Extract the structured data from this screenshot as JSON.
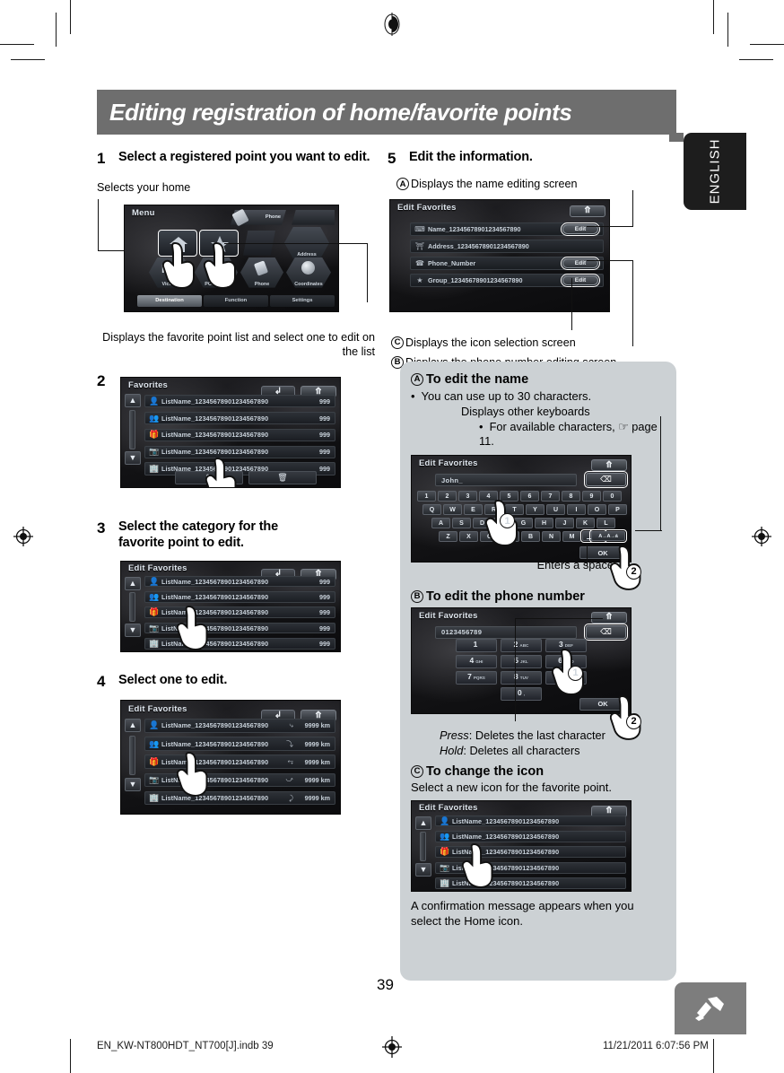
{
  "document": {
    "header_title": "Editing registration of home/favorite points",
    "page_number": "39",
    "language_tab": "ENGLISH",
    "footer_file": "EN_KW-NT800HDT_NT700[J].indb   39",
    "footer_page": "39",
    "footer_timestamp": "11/21/2011   6:07:56 PM",
    "colors": {
      "header_bar": "#6e6e6e",
      "info_box": "#ccd1d4",
      "lang_tab": "#1d1d1d",
      "badge": "#7d7d7d"
    }
  },
  "steps": {
    "step1": {
      "num": "1",
      "text": "Select a registered point you want to edit.",
      "caption_home": "Selects your home",
      "caption_favorites": "Displays the favorite point list and select one to edit on the list"
    },
    "step2": {
      "num": "2"
    },
    "step3": {
      "num": "3",
      "text": "Select the category for the favorite point to edit."
    },
    "step4": {
      "num": "4",
      "text": "Select one to edit."
    },
    "step5": {
      "num": "5",
      "text": "Edit the information.",
      "callout_a": "Displays the name editing screen",
      "callout_b": "Displays the phone number editing screen",
      "callout_c": "Displays the icon selection screen"
    }
  },
  "menu_screen": {
    "title": "Menu",
    "phone_label": "Phone",
    "tiles": [
      {
        "label": "",
        "icon": "home-icon"
      },
      {
        "label": "",
        "icon": "star-icon"
      },
      {
        "label": "",
        "icon": "route-icon"
      },
      {
        "label": "Address",
        "icon": "address-icon"
      },
      {
        "label": "Vicinity",
        "icon": "parking-icon"
      },
      {
        "label": "POI Name",
        "icon": "abc-icon"
      },
      {
        "label": "Phone",
        "icon": "phone-icon"
      },
      {
        "label": "Coordinates",
        "icon": "globe-icon"
      }
    ],
    "tabs": [
      {
        "label": "Destination",
        "active": true
      },
      {
        "label": "Function",
        "active": false
      },
      {
        "label": "Settings",
        "active": false
      }
    ]
  },
  "favorites_screen": {
    "title": "Favorites",
    "rows": [
      {
        "icon": "person-icon",
        "name": "ListName_12345678901234567890",
        "value": "999"
      },
      {
        "icon": "people-icon",
        "name": "ListName_12345678901234567890",
        "value": "999"
      },
      {
        "icon": "gift-icon",
        "name": "ListName_12345678901234567890",
        "value": "999"
      },
      {
        "icon": "camera-icon",
        "name": "ListName_12345678901234567890",
        "value": "999"
      },
      {
        "icon": "building-icon",
        "name": "ListName_12345678901234567890",
        "value": "999"
      }
    ],
    "scroll_up": "▲",
    "scroll_down": "▼",
    "edit_button_icon": "edit-pencil-icon",
    "delete_button_icon": "trash-icon",
    "back_icon": "↩",
    "return_icon": "⤴"
  },
  "edit_favorites_list": {
    "title": "Edit Favorites",
    "rows": [
      {
        "icon": "person-icon",
        "name": "ListName_12345678901234567890",
        "value": "999"
      },
      {
        "icon": "people-icon",
        "name": "ListName_12345678901234567890",
        "value": "999"
      },
      {
        "icon": "gift-icon",
        "name": "ListName_12345678901234567890",
        "value": "999"
      },
      {
        "icon": "camera-icon",
        "name": "ListName_12345678901234567890",
        "value": "999"
      },
      {
        "icon": "building-icon",
        "name": "ListName_12345678901234567890",
        "value": "999"
      }
    ]
  },
  "edit_favorites_distance": {
    "title": "Edit Favorites",
    "rows": [
      {
        "icon": "person-icon",
        "name": "ListName_12345678901234567890",
        "route": "route-a-icon",
        "value": "9999 km"
      },
      {
        "icon": "people-icon",
        "name": "ListName_12345678901234567890",
        "route": "route-b-icon",
        "value": "9999 km"
      },
      {
        "icon": "gift-icon",
        "name": "ListName_12345678901234567890",
        "route": "route-c-icon",
        "value": "9999 km"
      },
      {
        "icon": "camera-icon",
        "name": "ListName_12345678901234567890",
        "route": "route-d-icon",
        "value": "9999 km"
      },
      {
        "icon": "building-icon",
        "name": "ListName_12345678901234567890",
        "route": "route-e-icon",
        "value": "9999 km"
      }
    ]
  },
  "edit_favorites_detail": {
    "title": "Edit Favorites",
    "fields": [
      {
        "icon": "name-icon",
        "label": "Name_12345678901234567890",
        "button": "Edit",
        "has_button": true
      },
      {
        "icon": "address-icon",
        "label": "Address_12345678901234567890",
        "button": "",
        "has_button": false
      },
      {
        "icon": "phone-icon",
        "label": "Phone_Number",
        "button": "Edit",
        "has_button": true
      },
      {
        "icon": "star-icon",
        "label": "Group_12345678901234567890",
        "button": "Edit",
        "has_button": true
      }
    ]
  },
  "icon_selection_screen": {
    "title": "Edit Favorites",
    "rows": [
      {
        "icon": "person-icon",
        "name": "ListName_12345678901234567890"
      },
      {
        "icon": "people-icon",
        "name": "ListName_12345678901234567890"
      },
      {
        "icon": "gift-icon",
        "name": "ListName_12345678901234567890"
      },
      {
        "icon": "camera-icon",
        "name": "ListName_12345678901234567890"
      },
      {
        "icon": "building-icon",
        "name": "ListName_12345678901234567890"
      }
    ]
  },
  "section_a": {
    "marker": "A",
    "heading": "To edit the name",
    "bullet": "You can use up to 30 characters.",
    "callout_keyboards": "Displays other keyboards",
    "callout_chars": "For available characters, ☞ page 11.",
    "callout_space": "Enters a space",
    "keyboard": {
      "title": "Edit Favorites",
      "field_value": "John_",
      "delete_icon": "backspace-icon",
      "row_numbers": [
        "1",
        "2",
        "3",
        "4",
        "5",
        "6",
        "7",
        "8",
        "9",
        "0"
      ],
      "row_q": [
        "Q",
        "W",
        "E",
        "R",
        "T",
        "Y",
        "U",
        "I",
        "O",
        "P"
      ],
      "row_a": [
        "A",
        "S",
        "D",
        "F",
        "G",
        "H",
        "J",
        "K",
        "L"
      ],
      "row_z": [
        "Z",
        "X",
        "C",
        "V",
        "B",
        "N",
        "M"
      ],
      "space_key": "space-key",
      "switch_key": "A→A→á",
      "ok_label": "OK",
      "marker1": "1",
      "marker2": "2"
    }
  },
  "section_b": {
    "marker": "B",
    "heading": "To edit the phone number",
    "note_press_label": "Press",
    "note_press": ": Deletes the last character",
    "note_hold_label": "Hold",
    "note_hold": ": Deletes all characters",
    "keypad": {
      "title": "Edit Favorites",
      "field_value": "0123456789",
      "delete_icon": "backspace-icon",
      "keys": [
        {
          "digit": "1",
          "letters": ""
        },
        {
          "digit": "2",
          "letters": "ABC"
        },
        {
          "digit": "3",
          "letters": "DEF"
        },
        {
          "digit": "4",
          "letters": "GHI"
        },
        {
          "digit": "5",
          "letters": "JKL"
        },
        {
          "digit": "6",
          "letters": "MNO"
        },
        {
          "digit": "7",
          "letters": "PQRS"
        },
        {
          "digit": "8",
          "letters": "TUV"
        },
        {
          "digit": "9",
          "letters": "WXYZ"
        },
        {
          "digit": "0",
          "letters": ","
        }
      ],
      "ok_label": "OK",
      "marker1": "1",
      "marker2": "2"
    }
  },
  "section_c": {
    "marker": "C",
    "heading": "To change the icon",
    "intro": "Select a new icon for the favorite point.",
    "note": "A confirmation message appears when you select the Home icon."
  }
}
